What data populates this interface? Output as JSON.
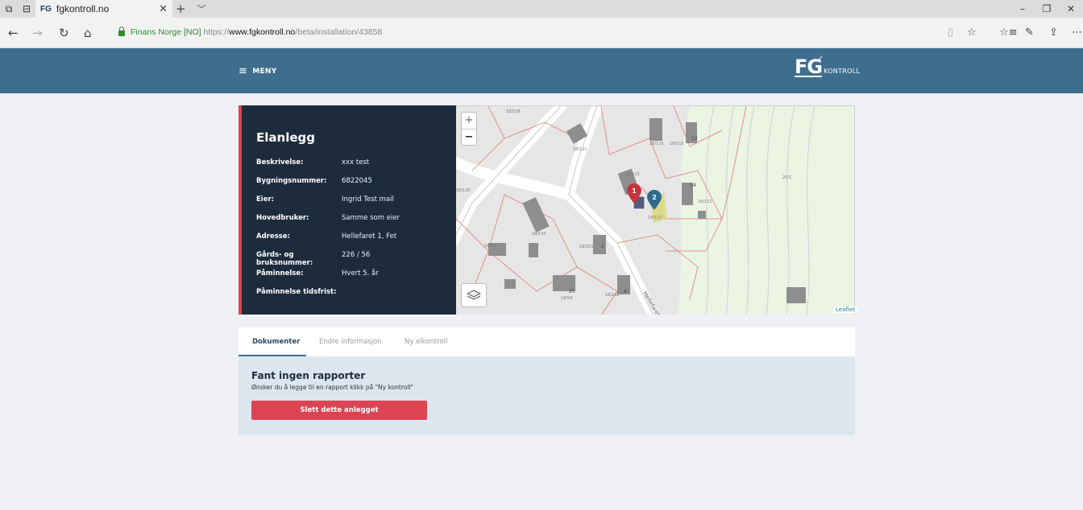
{
  "browser": {
    "tab_title": "fgkontroll.no",
    "tab_favicon": "FG",
    "cert_owner": "Finans Norge [NO]",
    "url_scheme": "https://",
    "url_host": "www.fgkontroll.no",
    "url_path": "/beta/installation/43858"
  },
  "header": {
    "menu_label": "MENY",
    "logo_fg": "FG",
    "logo_text": "KONTROLL"
  },
  "installation": {
    "title": "Elanlegg",
    "fields": [
      {
        "label": "Beskrivelse:",
        "value": "xxx test"
      },
      {
        "label": "Bygningsnummer:",
        "value": "6822045"
      },
      {
        "label": "Eier:",
        "value": "Ingrid Test mail"
      },
      {
        "label": "Hovedbruker:",
        "value": "Samme som eier"
      },
      {
        "label": "Adresse:",
        "value": "Hellefaret 1, Fet"
      },
      {
        "label": "Gårds- og bruksnummer:",
        "value": "226 / 56"
      },
      {
        "label": "Påminnelse:",
        "value": "Hvert 5. år"
      },
      {
        "label": "Påminnelse tidsfrist:",
        "value": ""
      }
    ]
  },
  "map": {
    "zoom_in": "+",
    "zoom_out": "−",
    "attribution": "Leaflet",
    "marker_1": "1",
    "marker_2": "2",
    "street_label": "Hellefaret",
    "parcel_labels": [
      "18/128",
      "18/121",
      "18/116",
      "18/115",
      "18/112",
      "18/113",
      "18/125",
      "18/110",
      "18/111",
      "18/101",
      "18/102",
      "18/99",
      "18/54",
      "20/1",
      "12",
      "14",
      "20",
      "4",
      "2"
    ]
  },
  "tabs": {
    "items": [
      "Dokumenter",
      "Endre informasjon",
      "Ny elkontroll"
    ],
    "active_index": 0
  },
  "reports": {
    "empty_title": "Fant ingen rapporter",
    "empty_text": "Ønsker du å legge til en rapport klikk på \"Ny kontroll\"",
    "delete_button": "Slett dette anlegget"
  },
  "colors": {
    "header_bg": "#3f6d8e",
    "card_bg": "#1d2c3c",
    "accent_red": "#dc4452",
    "marker_blue": "#2f6a8a"
  }
}
